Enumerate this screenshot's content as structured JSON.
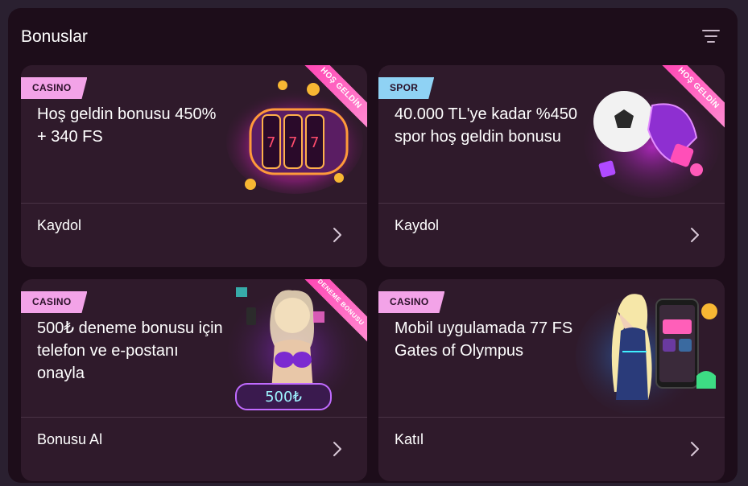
{
  "panel": {
    "title": "Bonuslar"
  },
  "cards": [
    {
      "tag": "CASINO",
      "title": "Hoş geldin bonusu 450% + 340 FS",
      "action": "Kaydol",
      "ribbon": "HOŞ GELDİN"
    },
    {
      "tag": "SPOR",
      "title": "40.000 TL'ye kadar %450 spor hoş geldin bonusu",
      "action": "Kaydol",
      "ribbon": "HOŞ GELDİN"
    },
    {
      "tag": "CASINO",
      "title": "500₺ deneme bonusu için telefon ve e-postanı onayla",
      "action": "Bonusu Al",
      "ribbon": "DENEME BONUSU",
      "badge": "500₺"
    },
    {
      "tag": "CASINO",
      "title": "Mobil uygulamada 77 FS Gates of Olympus",
      "action": "Katıl"
    }
  ],
  "colors": {
    "panel_bg": "#1d0d1a",
    "card_bg": "#2f1a2b",
    "tag_casino": "#f3a3e8",
    "tag_spor": "#8fd2f4",
    "ribbon": "#ff3fb1"
  },
  "icons": [
    "filter-icon",
    "chevron-right-icon"
  ]
}
